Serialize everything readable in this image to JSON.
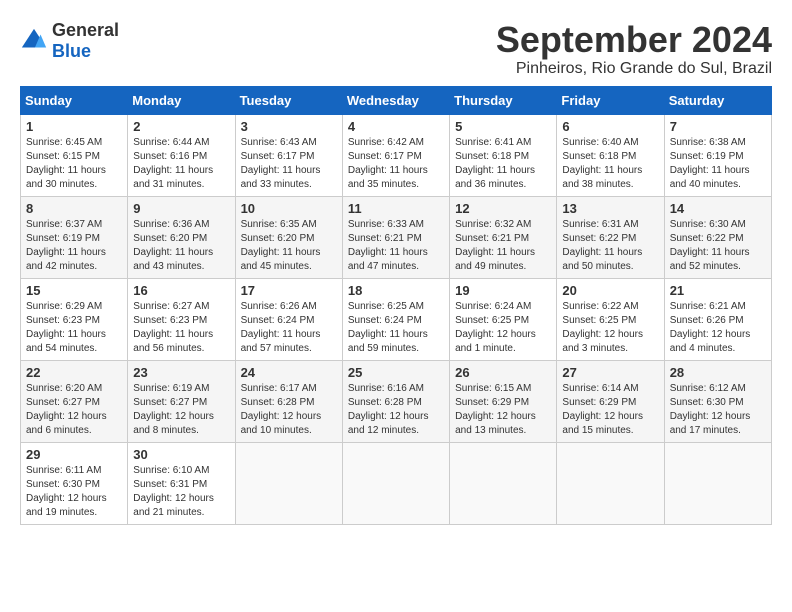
{
  "header": {
    "logo_general": "General",
    "logo_blue": "Blue",
    "month_title": "September 2024",
    "location": "Pinheiros, Rio Grande do Sul, Brazil"
  },
  "weekdays": [
    "Sunday",
    "Monday",
    "Tuesday",
    "Wednesday",
    "Thursday",
    "Friday",
    "Saturday"
  ],
  "weeks": [
    [
      {
        "day": "1",
        "sunrise": "6:45 AM",
        "sunset": "6:15 PM",
        "daylight": "11 hours and 30 minutes."
      },
      {
        "day": "2",
        "sunrise": "6:44 AM",
        "sunset": "6:16 PM",
        "daylight": "11 hours and 31 minutes."
      },
      {
        "day": "3",
        "sunrise": "6:43 AM",
        "sunset": "6:17 PM",
        "daylight": "11 hours and 33 minutes."
      },
      {
        "day": "4",
        "sunrise": "6:42 AM",
        "sunset": "6:17 PM",
        "daylight": "11 hours and 35 minutes."
      },
      {
        "day": "5",
        "sunrise": "6:41 AM",
        "sunset": "6:18 PM",
        "daylight": "11 hours and 36 minutes."
      },
      {
        "day": "6",
        "sunrise": "6:40 AM",
        "sunset": "6:18 PM",
        "daylight": "11 hours and 38 minutes."
      },
      {
        "day": "7",
        "sunrise": "6:38 AM",
        "sunset": "6:19 PM",
        "daylight": "11 hours and 40 minutes."
      }
    ],
    [
      {
        "day": "8",
        "sunrise": "6:37 AM",
        "sunset": "6:19 PM",
        "daylight": "11 hours and 42 minutes."
      },
      {
        "day": "9",
        "sunrise": "6:36 AM",
        "sunset": "6:20 PM",
        "daylight": "11 hours and 43 minutes."
      },
      {
        "day": "10",
        "sunrise": "6:35 AM",
        "sunset": "6:20 PM",
        "daylight": "11 hours and 45 minutes."
      },
      {
        "day": "11",
        "sunrise": "6:33 AM",
        "sunset": "6:21 PM",
        "daylight": "11 hours and 47 minutes."
      },
      {
        "day": "12",
        "sunrise": "6:32 AM",
        "sunset": "6:21 PM",
        "daylight": "11 hours and 49 minutes."
      },
      {
        "day": "13",
        "sunrise": "6:31 AM",
        "sunset": "6:22 PM",
        "daylight": "11 hours and 50 minutes."
      },
      {
        "day": "14",
        "sunrise": "6:30 AM",
        "sunset": "6:22 PM",
        "daylight": "11 hours and 52 minutes."
      }
    ],
    [
      {
        "day": "15",
        "sunrise": "6:29 AM",
        "sunset": "6:23 PM",
        "daylight": "11 hours and 54 minutes."
      },
      {
        "day": "16",
        "sunrise": "6:27 AM",
        "sunset": "6:23 PM",
        "daylight": "11 hours and 56 minutes."
      },
      {
        "day": "17",
        "sunrise": "6:26 AM",
        "sunset": "6:24 PM",
        "daylight": "11 hours and 57 minutes."
      },
      {
        "day": "18",
        "sunrise": "6:25 AM",
        "sunset": "6:24 PM",
        "daylight": "11 hours and 59 minutes."
      },
      {
        "day": "19",
        "sunrise": "6:24 AM",
        "sunset": "6:25 PM",
        "daylight": "12 hours and 1 minute."
      },
      {
        "day": "20",
        "sunrise": "6:22 AM",
        "sunset": "6:25 PM",
        "daylight": "12 hours and 3 minutes."
      },
      {
        "day": "21",
        "sunrise": "6:21 AM",
        "sunset": "6:26 PM",
        "daylight": "12 hours and 4 minutes."
      }
    ],
    [
      {
        "day": "22",
        "sunrise": "6:20 AM",
        "sunset": "6:27 PM",
        "daylight": "12 hours and 6 minutes."
      },
      {
        "day": "23",
        "sunrise": "6:19 AM",
        "sunset": "6:27 PM",
        "daylight": "12 hours and 8 minutes."
      },
      {
        "day": "24",
        "sunrise": "6:17 AM",
        "sunset": "6:28 PM",
        "daylight": "12 hours and 10 minutes."
      },
      {
        "day": "25",
        "sunrise": "6:16 AM",
        "sunset": "6:28 PM",
        "daylight": "12 hours and 12 minutes."
      },
      {
        "day": "26",
        "sunrise": "6:15 AM",
        "sunset": "6:29 PM",
        "daylight": "12 hours and 13 minutes."
      },
      {
        "day": "27",
        "sunrise": "6:14 AM",
        "sunset": "6:29 PM",
        "daylight": "12 hours and 15 minutes."
      },
      {
        "day": "28",
        "sunrise": "6:12 AM",
        "sunset": "6:30 PM",
        "daylight": "12 hours and 17 minutes."
      }
    ],
    [
      {
        "day": "29",
        "sunrise": "6:11 AM",
        "sunset": "6:30 PM",
        "daylight": "12 hours and 19 minutes."
      },
      {
        "day": "30",
        "sunrise": "6:10 AM",
        "sunset": "6:31 PM",
        "daylight": "12 hours and 21 minutes."
      },
      null,
      null,
      null,
      null,
      null
    ]
  ]
}
